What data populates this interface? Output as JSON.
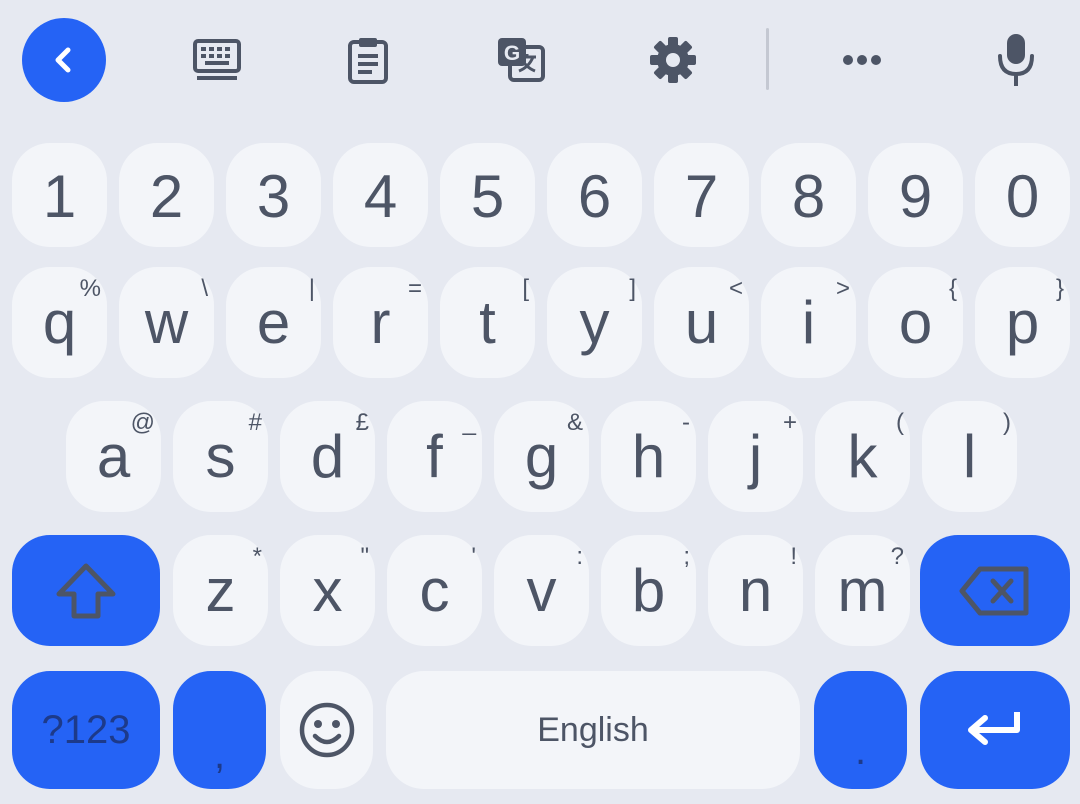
{
  "toolbar": {
    "icons": [
      "back-icon",
      "keyboard-icon",
      "clipboard-icon",
      "translate-icon",
      "settings-icon",
      "more-icon",
      "mic-icon"
    ]
  },
  "rows": {
    "numbers": [
      "1",
      "2",
      "3",
      "4",
      "5",
      "6",
      "7",
      "8",
      "9",
      "0"
    ],
    "row1": [
      {
        "key": "q",
        "hint": "%"
      },
      {
        "key": "w",
        "hint": "\\"
      },
      {
        "key": "e",
        "hint": "|"
      },
      {
        "key": "r",
        "hint": "="
      },
      {
        "key": "t",
        "hint": "["
      },
      {
        "key": "y",
        "hint": "]"
      },
      {
        "key": "u",
        "hint": "<"
      },
      {
        "key": "i",
        "hint": ">"
      },
      {
        "key": "o",
        "hint": "{"
      },
      {
        "key": "p",
        "hint": "}"
      }
    ],
    "row2": [
      {
        "key": "a",
        "hint": "@"
      },
      {
        "key": "s",
        "hint": "#"
      },
      {
        "key": "d",
        "hint": "£"
      },
      {
        "key": "f",
        "hint": "_"
      },
      {
        "key": "g",
        "hint": "&"
      },
      {
        "key": "h",
        "hint": "-"
      },
      {
        "key": "j",
        "hint": "+"
      },
      {
        "key": "k",
        "hint": "("
      },
      {
        "key": "l",
        "hint": ")"
      }
    ],
    "row3": [
      {
        "key": "z",
        "hint": "*"
      },
      {
        "key": "x",
        "hint": "\""
      },
      {
        "key": "c",
        "hint": "'"
      },
      {
        "key": "v",
        "hint": ":"
      },
      {
        "key": "b",
        "hint": ";"
      },
      {
        "key": "n",
        "hint": "!"
      },
      {
        "key": "m",
        "hint": "?"
      }
    ]
  },
  "bottom": {
    "symbols_label": "?123",
    "comma_label": ",",
    "space_label": "English",
    "period_label": "."
  },
  "colors": {
    "accent": "#2563f5",
    "key_bg": "#f3f5f9",
    "background": "#e6e9f1",
    "key_text": "#4d5566"
  }
}
